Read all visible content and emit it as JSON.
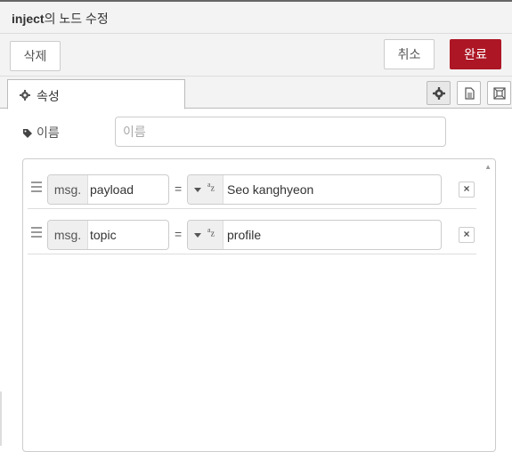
{
  "titlebar": {
    "title_prefix": "inject",
    "title_suffix": "의 노드 수정"
  },
  "toolbar": {
    "delete_label": "삭제",
    "cancel_label": "취소",
    "done_label": "완료"
  },
  "tabs": {
    "properties_label": "속성"
  },
  "name": {
    "label": "이름",
    "placeholder": "이름",
    "value": ""
  },
  "rows": [
    {
      "prefix": "msg.",
      "field": "payload",
      "equals": "=",
      "type_icon": "az-string",
      "value": "Seo kanghyeon"
    },
    {
      "prefix": "msg.",
      "field": "topic",
      "equals": "=",
      "type_icon": "az-string",
      "value": "profile"
    }
  ],
  "icons": {
    "gear": "gear-icon",
    "tag": "tag-icon",
    "doc": "document-icon",
    "appearance": "frame-icon"
  },
  "colors": {
    "accent": "#ad1625"
  }
}
